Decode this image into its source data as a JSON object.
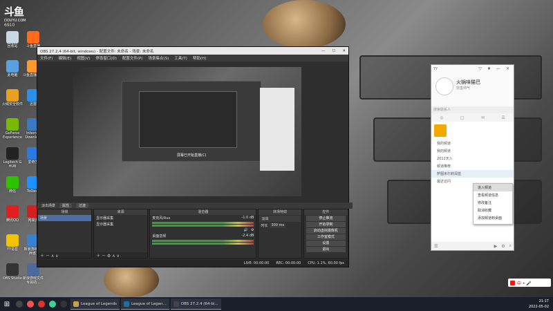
{
  "desktop": {
    "logo": {
      "line1": "斗鱼",
      "line2": "DOUYU.COM",
      "room": "6910"
    },
    "icons": [
      {
        "label": "回收站",
        "name": "recycle-bin-icon",
        "color": "#c9d6e3"
      },
      {
        "label": "斗鱼直播",
        "name": "douyu-icon",
        "color": "#ff6b1a"
      },
      {
        "label": "此电脑",
        "name": "computer-icon",
        "color": "#5aa0e0"
      },
      {
        "label": "斗鱼直播伴侣",
        "name": "douyu-companion-icon",
        "color": "#ff9a2a"
      },
      {
        "label": "火绒安全软件",
        "name": "huorong-icon",
        "color": "#e8a020"
      },
      {
        "label": "迅雷",
        "name": "xunlei-icon",
        "color": "#2a90e8"
      },
      {
        "label": "GeForce Experience",
        "name": "geforce-icon",
        "color": "#76b900"
      },
      {
        "label": "Internet Downlo...",
        "name": "idm-icon",
        "color": "#3a7ac0"
      },
      {
        "label": "Logitech G HUB",
        "name": "logitech-icon",
        "color": "#222222"
      },
      {
        "label": "爱奇艺",
        "name": "iqiyi-icon",
        "color": "#2a7ae0"
      },
      {
        "label": "微信",
        "name": "wechat-icon",
        "color": "#2dc100"
      },
      {
        "label": "ToDesk",
        "name": "todesk-icon",
        "color": "#1e90ff"
      },
      {
        "label": "腾讯QQ",
        "name": "qq-icon",
        "color": "#e02020"
      },
      {
        "label": "网易云",
        "name": "netease-icon",
        "color": "#d02020"
      },
      {
        "label": "YY语音",
        "name": "yy-icon",
        "color": "#f2c400"
      },
      {
        "label": "新浪游戏(江西省)",
        "name": "game-icon",
        "color": "#3a80d0"
      },
      {
        "label": "OBS Studio",
        "name": "obs-icon",
        "color": "#333333"
      },
      {
        "label": "新浪游戏文件专属助...",
        "name": "helper-icon",
        "color": "#4a6aa0"
      }
    ]
  },
  "obs": {
    "title": "OBS 27.2.4 (64-bit, windows) - 配置文件: 未命名 - 场景: 未命名",
    "menu": [
      "文件(F)",
      "编辑(E)",
      "视图(V)",
      "停靠窗口(D)",
      "配置文件(P)",
      "场景集合(S)",
      "工具(T)",
      "帮助(H)"
    ],
    "nested_caption": "屏幕已开始直播(C)",
    "transition": {
      "label": "淡出场景",
      "btn1": "属性",
      "btn2": "过渡"
    },
    "scenes": {
      "header": "场景",
      "items": [
        "场景"
      ]
    },
    "sources": {
      "header": "来源",
      "items": [
        "显示器采集",
        "显示器采集"
      ]
    },
    "mixer": {
      "header": "混音器",
      "tracks": [
        {
          "name": "麦克风/Aux",
          "db": "-1.0 dB"
        },
        {
          "name": "桌面音频",
          "db": "-2.4 dB"
        }
      ]
    },
    "transitions_dock": {
      "header": "转场特效",
      "type": "淡出",
      "duration_label": "时长",
      "duration": "300 ms"
    },
    "controls": {
      "header": "控件",
      "buttons": [
        "停止推流",
        "开始录制",
        "启动虚拟摄像机",
        "工作室模式",
        "设置",
        "退出"
      ]
    },
    "status": {
      "live": "LIVE: 00:00:00",
      "rec": "REC: 00:00:00",
      "cpu": "CPU: 1.1%, 60.00 fps"
    }
  },
  "yy": {
    "title": "YY",
    "user_name": "火锅味猫巴",
    "user_sub": "完善帅气",
    "search_placeholder": "搜索联系人",
    "tabs": [
      "◎",
      "□",
      "✉",
      "☰"
    ],
    "sections": [
      "我的频道",
      "我的频道",
      "2012天入",
      "频道推荐",
      "最近访问"
    ],
    "contact": "萨图米尔莉深蓝"
  },
  "context_menu": {
    "items": [
      "进入频道",
      "查看频道信息",
      "修改备注",
      "取消收藏",
      "添加频道到桌面"
    ]
  },
  "taskbar": {
    "apps": [
      {
        "label": "League of Legends",
        "color": "#c8a34a"
      },
      {
        "label": "League of Legen...",
        "color": "#1e6fa0"
      },
      {
        "label": "OBS 27.2.4 (64-bi...",
        "color": "#444444"
      }
    ],
    "time": "21:17",
    "date": "2022-05-02",
    "tray": "中 • 🎤"
  }
}
